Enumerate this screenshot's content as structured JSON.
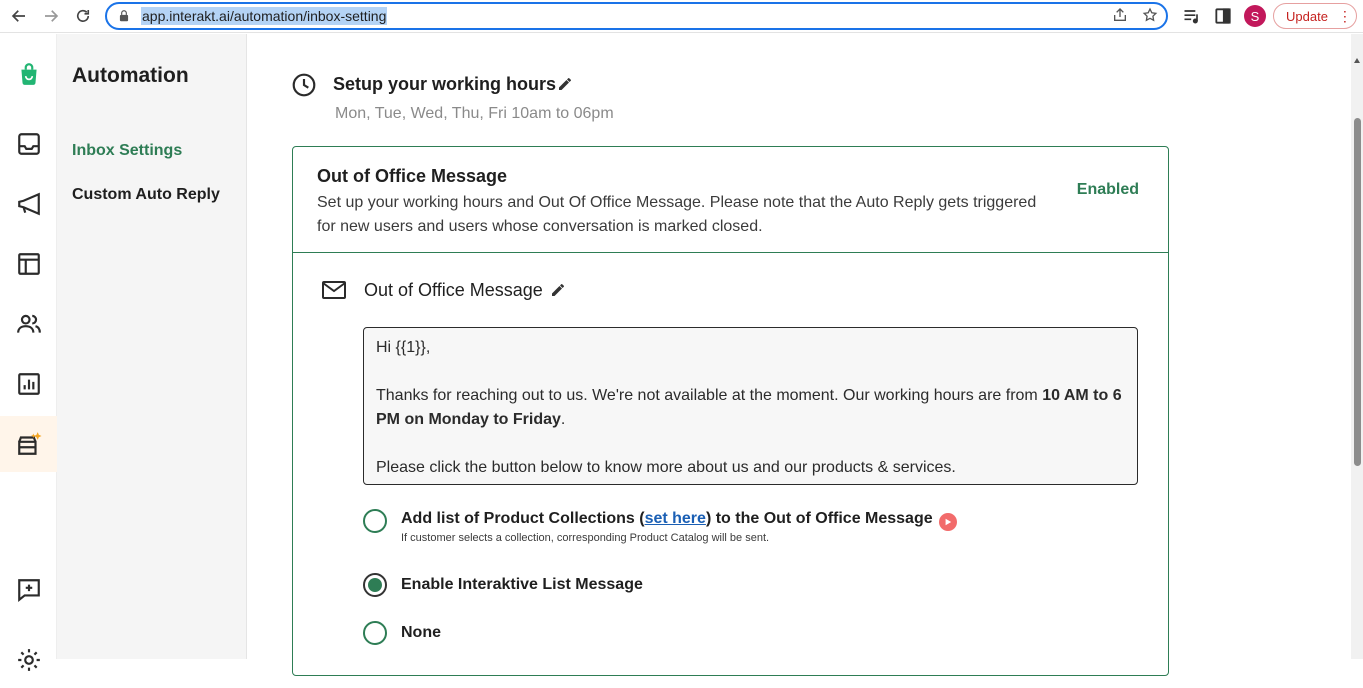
{
  "browser": {
    "url": "app.interakt.ai/automation/inbox-setting",
    "profile_initial": "S",
    "update_label": "Update",
    "update_menu": "⋮"
  },
  "sidebar": {
    "title": "Automation",
    "items": [
      {
        "label": "Inbox Settings",
        "active": true
      },
      {
        "label": "Custom Auto Reply",
        "active": false
      }
    ]
  },
  "working_hours": {
    "title": "Setup your working hours",
    "schedule": "Mon, Tue, Wed, Thu, Fri 10am to 06pm"
  },
  "ooo_card": {
    "title": "Out of Office Message",
    "description": "Set up your working hours and Out Of Office Message. Please note that the Auto Reply gets triggered for new users and users whose conversation is marked closed.",
    "status": "Enabled",
    "message_title": "Out of Office Message",
    "message": {
      "greeting": "Hi {{1}},",
      "body_prefix": "Thanks for reaching out to us. We're not available at the moment. Our working hours are from ",
      "body_bold": "10 AM to 6 PM on Monday to Friday",
      "body_suffix": ".",
      "closing": "Please click the button below to know more about us and our products & services."
    },
    "options": {
      "collections_prefix": "Add list of Product Collections (",
      "collections_link": "set here",
      "collections_suffix": ") to the Out of Office Message",
      "collections_hint": "If customer selects a collection, corresponding Product Catalog will be sent.",
      "list_message": "Enable Interaktive List Message",
      "none": "None",
      "selected": "list_message"
    }
  },
  "colors": {
    "accent": "#2e7d55",
    "link": "#1a5fb4",
    "update_red": "#c5221f"
  }
}
